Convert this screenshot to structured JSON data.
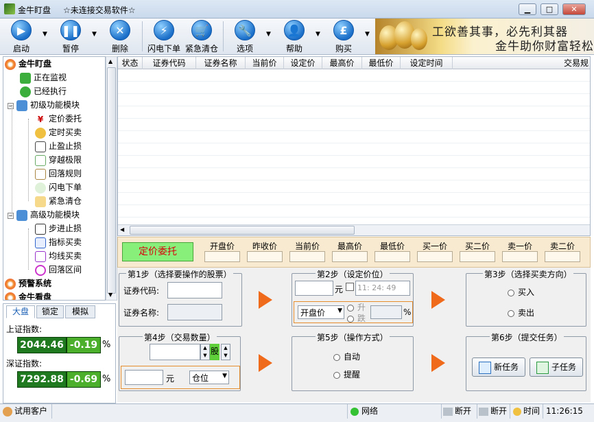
{
  "window": {
    "app_title": "金牛盯盘",
    "subtitle": "☆未连接交易软件☆",
    "btn_min": "▁",
    "btn_max": "□",
    "btn_close": "✕"
  },
  "toolbar": {
    "start": "启动",
    "pause": "暂停",
    "delete": "删除",
    "flash_order": "闪电下单",
    "clear_position": "紧急清仓",
    "options": "选项",
    "help": "帮助",
    "buy": "购买"
  },
  "banner": {
    "line1": "工欲善其事，必先利其器",
    "line2": "金牛助你财富轻松"
  },
  "tree": {
    "root": "金牛盯盘",
    "monitoring": "正在监视",
    "executed": "已经执行",
    "basic": "初级功能模块",
    "basic_items": [
      "定价委托",
      "定时买卖",
      "止盈止损",
      "穿越极限",
      "回落规则",
      "闪电下单",
      "紧急清仓"
    ],
    "advanced": "高级功能模块",
    "advanced_items": [
      "步进止损",
      "指标买卖",
      "均线买卖",
      "回落区间"
    ],
    "alert": "预警系统",
    "watch": "金牛看盘"
  },
  "index_panel": {
    "tabs": [
      "大盘",
      "锁定",
      "模拟"
    ],
    "sh_label": "上证指数:",
    "sh_value": "2044.46",
    "sh_change": "-0.19",
    "sz_label": "深证指数:",
    "sz_value": "7292.88",
    "sz_change": "-0.69",
    "pct": "%"
  },
  "grid": {
    "columns": [
      "状态",
      "证券代码",
      "证券名称",
      "当前价",
      "设定价",
      "最高价",
      "最低价",
      "设定时间",
      "交易规"
    ]
  },
  "price_bar": {
    "order_type": "定价委托",
    "fields": [
      "开盘价",
      "昨收价",
      "当前价",
      "最高价",
      "最低价",
      "买一价",
      "买二价",
      "卖一价",
      "卖二价"
    ]
  },
  "step1": {
    "title": "第1步（选择要操作的股票）",
    "code_label": "证券代码:",
    "name_label": "证券名称:"
  },
  "step2": {
    "title": "第2步（设定价位）",
    "unit": "元",
    "time": "11: 24: 49",
    "price_ref": "开盘价",
    "rise": "升",
    "fall": "跌",
    "pct": "%"
  },
  "step3": {
    "title": "第3步（选择买卖方向）",
    "buy": "买入",
    "sell": "卖出"
  },
  "step4": {
    "title": "第4步（交易数量）",
    "shares": "股",
    "unit": "元",
    "mode": "仓位"
  },
  "step5": {
    "title": "第5步（操作方式）",
    "auto": "自动",
    "remind": "提醒"
  },
  "step6": {
    "title": "第6步（提交任务）",
    "new_task": "新任务",
    "sub_task": "子任务"
  },
  "status": {
    "user": "试用客户",
    "network": "网络",
    "disc1": "断开",
    "disc2": "断开",
    "time_label": "时间",
    "time": "11:26:15"
  },
  "colors": {
    "index_value_bg": "#1f7a1f",
    "change_bg": "#4caf2c",
    "order_type_bg": "#88f07a",
    "order_type_text": "#d8000a",
    "arrow": "#f06a1b"
  }
}
